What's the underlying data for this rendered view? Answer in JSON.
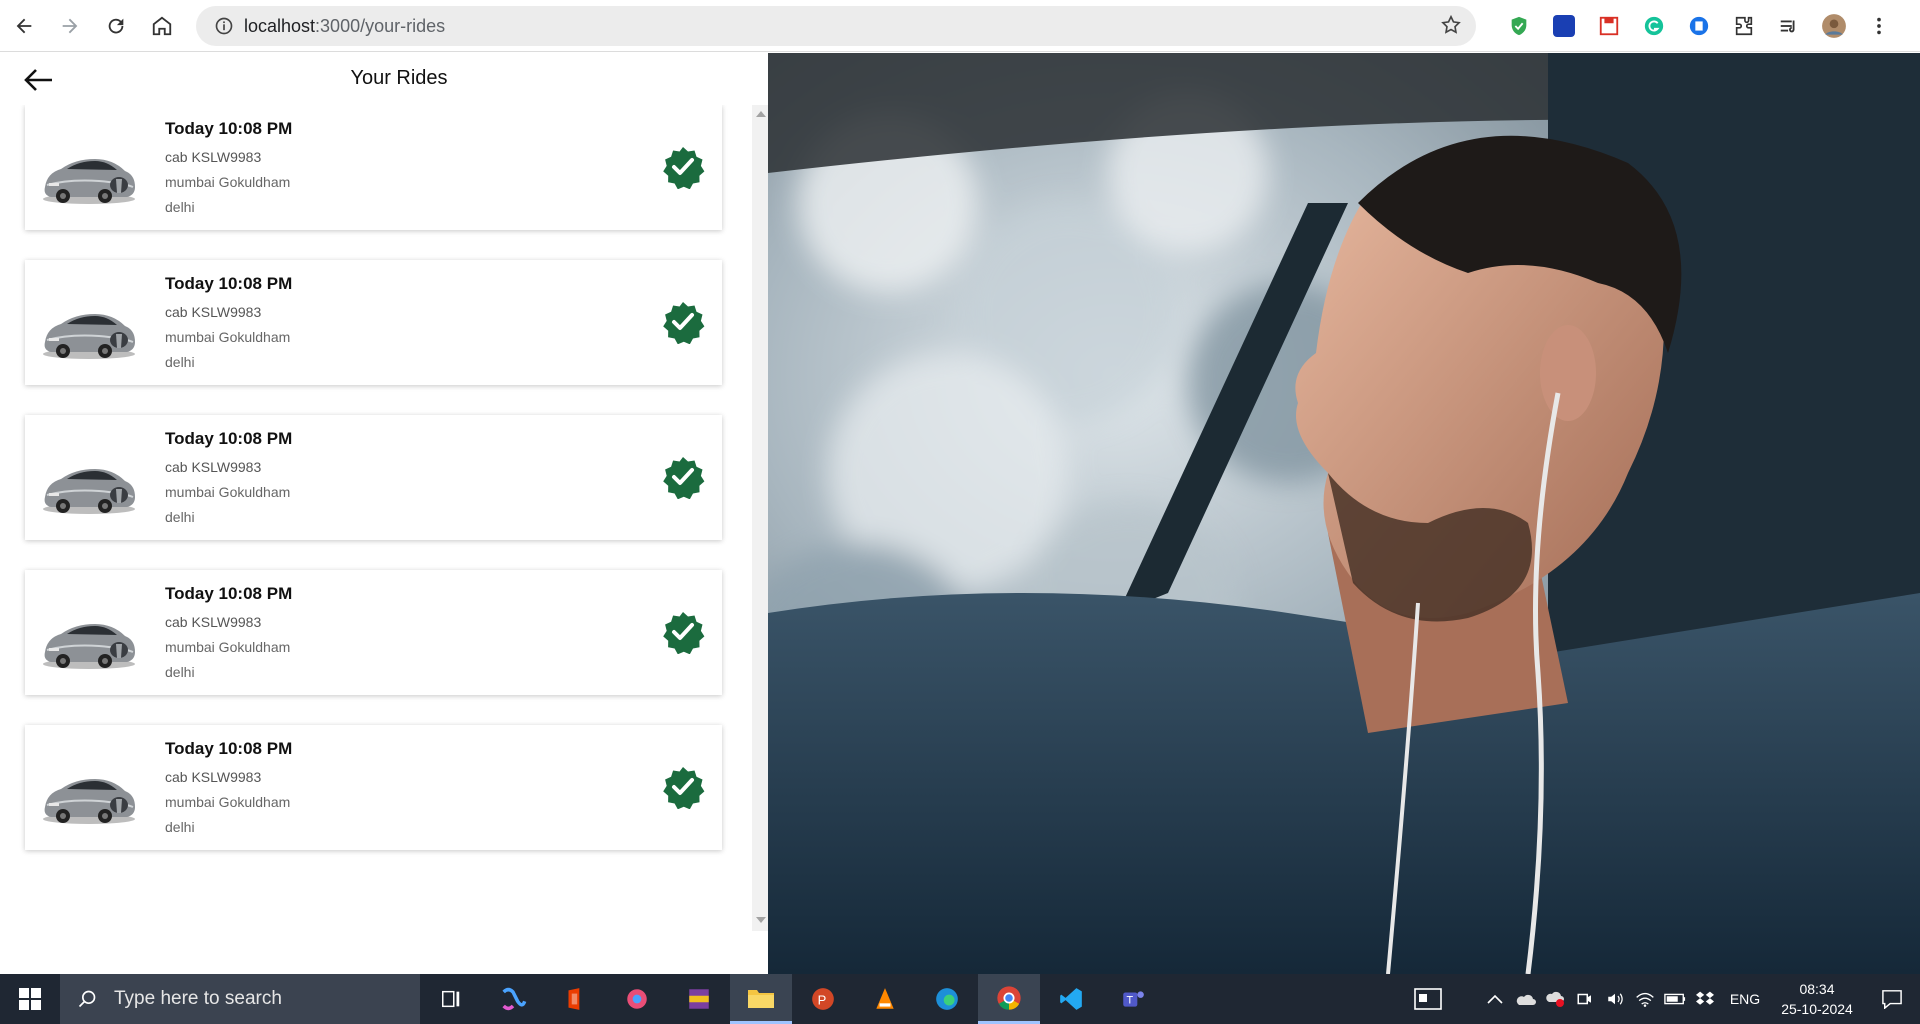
{
  "browser": {
    "url_host": "localhost",
    "url_path": ":3000/your-rides",
    "extensions": [
      "shield-ext",
      "translate-ext",
      "pdf-ext",
      "grammarly-ext",
      "document-ext",
      "extensions-puzzle",
      "media-control",
      "profile-avatar",
      "menu-dots"
    ]
  },
  "page": {
    "title": "Your Rides"
  },
  "rides": [
    {
      "time": "Today 10:08 PM",
      "cab": "cab KSLW9983",
      "from": "mumbai Gokuldham",
      "to": "delhi",
      "status_icon": "verified-check-icon"
    },
    {
      "time": "Today 10:08 PM",
      "cab": "cab KSLW9983",
      "from": "mumbai Gokuldham",
      "to": "delhi",
      "status_icon": "verified-check-icon"
    },
    {
      "time": "Today 10:08 PM",
      "cab": "cab KSLW9983",
      "from": "mumbai Gokuldham",
      "to": "delhi",
      "status_icon": "verified-check-icon"
    },
    {
      "time": "Today 10:08 PM",
      "cab": "cab KSLW9983",
      "from": "mumbai Gokuldham",
      "to": "delhi",
      "status_icon": "verified-check-icon"
    },
    {
      "time": "Today 10:08 PM",
      "cab": "cab KSLW9983",
      "from": "mumbai Gokuldham",
      "to": "delhi",
      "status_icon": "verified-check-icon"
    }
  ],
  "colors": {
    "check_green": "#1b6b3e",
    "taskbar_bg": "#1f2733"
  },
  "taskbar": {
    "search_placeholder": "Type here to search",
    "language": "ENG",
    "time": "08:34",
    "date": "25-10-2024"
  }
}
